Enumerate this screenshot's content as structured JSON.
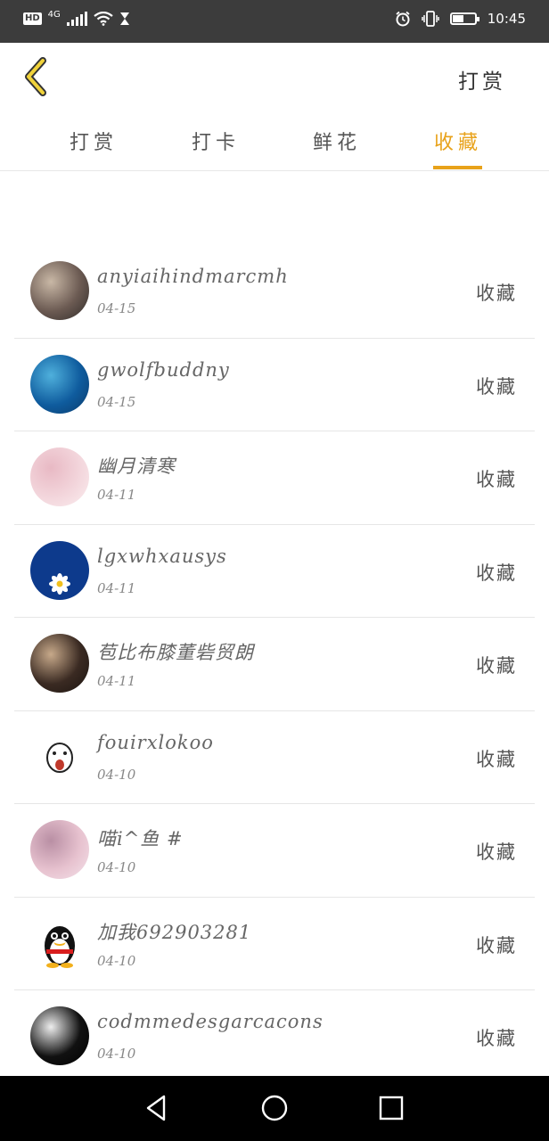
{
  "status_bar": {
    "hd": "HD",
    "network": "4G",
    "time": "10:45",
    "battery_level": 0.5
  },
  "header": {
    "back_icon": "chevron-left-icon",
    "action_label": "打赏"
  },
  "tabs": [
    {
      "label": "打赏",
      "active": false
    },
    {
      "label": "打卡",
      "active": false
    },
    {
      "label": "鲜花",
      "active": false
    },
    {
      "label": "收藏",
      "active": true
    }
  ],
  "accent_color": "#e8a21a",
  "items": [
    {
      "name": "anyiaihindmarcmh",
      "date": "04-15",
      "action": "收藏",
      "avatar_colors": [
        "#6b5a52",
        "#c9b8a6",
        "#2e2a28"
      ]
    },
    {
      "name": "gwolfbuddny",
      "date": "04-15",
      "action": "收藏",
      "avatar_colors": [
        "#0f5c9e",
        "#4fb0dc",
        "#0a3a6a"
      ]
    },
    {
      "name": "幽月清寒",
      "date": "04-11",
      "action": "收藏",
      "avatar_colors": [
        "#f3d6dc",
        "#e8b9c4",
        "#fbeef0"
      ]
    },
    {
      "name": "lgxwhxausys",
      "date": "04-11",
      "action": "收藏",
      "avatar_colors": [
        "#0d3a8c",
        "#0d3a8c",
        "#0d3a8c"
      ]
    },
    {
      "name": "苞比布膝董砦贸朗",
      "date": "04-11",
      "action": "收藏",
      "avatar_colors": [
        "#3a2a22",
        "#c7a98a",
        "#1b1410"
      ]
    },
    {
      "name": "fouirxlokoo",
      "date": "04-10",
      "action": "收藏",
      "avatar_colors": [
        "#ffffff",
        "#ffffff",
        "#ffffff"
      ]
    },
    {
      "name": "喵i^鱼 #",
      "date": "04-10",
      "action": "收藏",
      "avatar_colors": [
        "#e7c2cf",
        "#b98fa4",
        "#f4e2ea"
      ]
    },
    {
      "name": "加我692903281",
      "date": "04-10",
      "action": "收藏",
      "avatar_colors": [
        "#ffffff",
        "#ffffff",
        "#ffffff"
      ]
    },
    {
      "name": "codmmedesgarcacons",
      "date": "04-10",
      "action": "收藏",
      "avatar_colors": [
        "#111111",
        "#eeeeee",
        "#000000"
      ]
    }
  ],
  "nav": {
    "back_icon": "triangle-back-icon",
    "home_icon": "circle-home-icon",
    "recents_icon": "square-recents-icon"
  }
}
